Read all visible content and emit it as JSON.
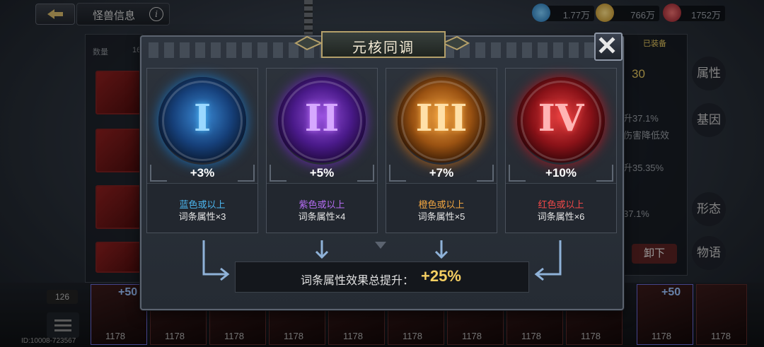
{
  "topbar": {
    "title": "怪兽信息",
    "resources": [
      {
        "icon": "crystal-icon",
        "value": "1.77万",
        "color": "#3fa4e6"
      },
      {
        "icon": "gold-icon",
        "value": "766万",
        "color": "#e5b842"
      },
      {
        "icon": "exp-icon",
        "value": "1752万",
        "color": "#c63b4a"
      }
    ]
  },
  "background": {
    "left_label": "数量",
    "left_count": "16",
    "right_status": "已装备",
    "right_level": "30",
    "right_lines": [
      "升37.1%",
      "伤害降低效",
      "升35.35%",
      "37.1%"
    ],
    "side_tabs": [
      "属性",
      "基因",
      "形态",
      "物语"
    ],
    "unequip_label": "卸下",
    "count_label": "126",
    "plus_badge": "+50",
    "card_level": "1178",
    "uid": "ID:10008-723567"
  },
  "dialog": {
    "title": "元核同调",
    "cards": [
      {
        "numeral": "I",
        "percent": "+3%",
        "condition": "蓝色或以上",
        "attribute": "词条属性×3",
        "color": "#4cb7f0",
        "glow": "#1c6fb8"
      },
      {
        "numeral": "II",
        "percent": "+5%",
        "condition": "紫色或以上",
        "attribute": "词条属性×4",
        "color": "#b46cf2",
        "glow": "#6a2cb4"
      },
      {
        "numeral": "III",
        "percent": "+7%",
        "condition": "橙色或以上",
        "attribute": "词条属性×5",
        "color": "#f2a640",
        "glow": "#b8661a"
      },
      {
        "numeral": "IV",
        "percent": "+10%",
        "condition": "红色或以上",
        "attribute": "词条属性×6",
        "color": "#f04848",
        "glow": "#a61c24"
      }
    ],
    "total_label": "词条属性效果总提升：",
    "total_value": "+25%"
  }
}
